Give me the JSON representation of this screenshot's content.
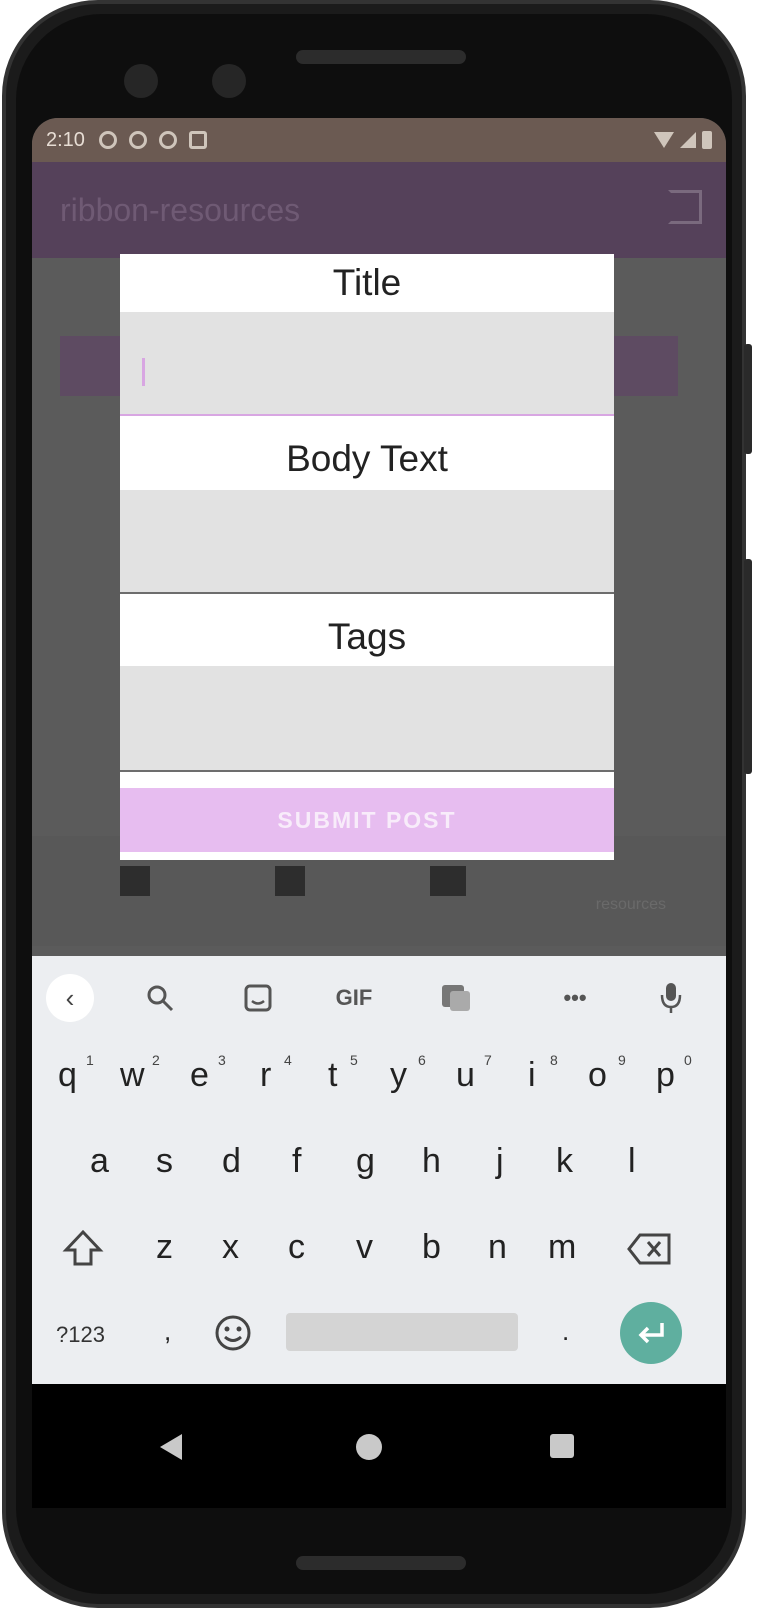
{
  "status_bar": {
    "time": "2:10"
  },
  "app_bar": {
    "title": "ribbon-resources"
  },
  "dialog": {
    "title_label": "Title",
    "title_value": "",
    "body_label": "Body Text",
    "body_value": "",
    "tags_label": "Tags",
    "tags_value": "",
    "submit_label": "SUBMIT POST"
  },
  "bottom_nav": {
    "right_label": "resources"
  },
  "keyboard": {
    "tool_gif": "GIF",
    "tool_more": "•••",
    "row1": [
      "q",
      "w",
      "e",
      "r",
      "t",
      "y",
      "u",
      "i",
      "o",
      "p"
    ],
    "row1_nums": [
      "1",
      "2",
      "3",
      "4",
      "5",
      "6",
      "7",
      "8",
      "9",
      "0"
    ],
    "row2": [
      "a",
      "s",
      "d",
      "f",
      "g",
      "h",
      "j",
      "k",
      "l"
    ],
    "row3": [
      "z",
      "x",
      "c",
      "v",
      "b",
      "n",
      "m"
    ],
    "symbols_key": "?123",
    "comma_key": ",",
    "period_key": "."
  }
}
